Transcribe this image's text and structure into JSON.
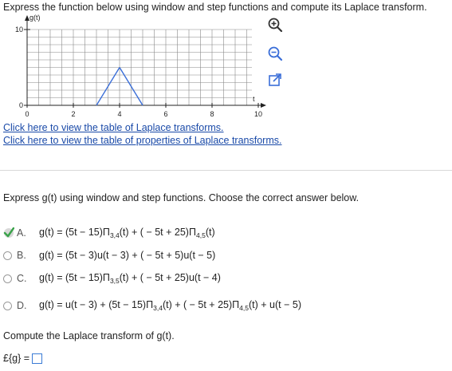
{
  "prompt": "Express the function below using window and step functions and compute its Laplace transform.",
  "graph": {
    "y_axis_label": "g(t)",
    "x_axis_label": "t",
    "y_ticks": [
      "10",
      "0"
    ],
    "x_ticks": [
      "0",
      "2",
      "4",
      "6",
      "8",
      "10"
    ],
    "line_color": "#3a6ed8"
  },
  "chart_data": {
    "type": "line",
    "x": [
      0,
      3,
      4,
      5,
      10
    ],
    "y": [
      0,
      0,
      5,
      0,
      0
    ],
    "xlim": [
      0,
      10
    ],
    "ylim": [
      0,
      10
    ],
    "grid": true,
    "xlabel": "t",
    "ylabel": "g(t)"
  },
  "tools": {
    "zoom_in": "zoom-in-icon",
    "zoom_out": "zoom-out-icon",
    "popout": "popout-icon"
  },
  "links": {
    "laplace_table": "Click here to view the table of Laplace transforms.",
    "properties_table": "Click here to view the table of properties of Laplace transforms."
  },
  "question": "Express g(t) using window and step functions. Choose the correct answer below.",
  "options": [
    {
      "letter": "A.",
      "lhs": "g(t) = (5t − 15)Π",
      "sub1": "3,4",
      "mid": "(t) + ( − 5t + 25)Π",
      "sub2": "4,5",
      "end": "(t)",
      "selected": true
    },
    {
      "letter": "B.",
      "text": "g(t) = (5t − 3)u(t − 3) + ( − 5t + 5)u(t − 5)",
      "selected": false
    },
    {
      "letter": "C.",
      "lhs": "g(t) = (5t − 15)Π",
      "sub1": "3,5",
      "end": "(t) + ( − 5t + 25)u(t − 4)",
      "selected": false
    },
    {
      "letter": "D.",
      "lhs": "g(t) = u(t − 3) + (5t − 15)Π",
      "sub1": "3,4",
      "mid": "(t) + ( − 5t + 25)Π",
      "sub2": "4,5",
      "end": "(t) + u(t − 5)",
      "selected": false
    }
  ],
  "compute_label": "Compute the Laplace transform of g(t).",
  "answer_label": "£{g} =",
  "answer_value": ""
}
